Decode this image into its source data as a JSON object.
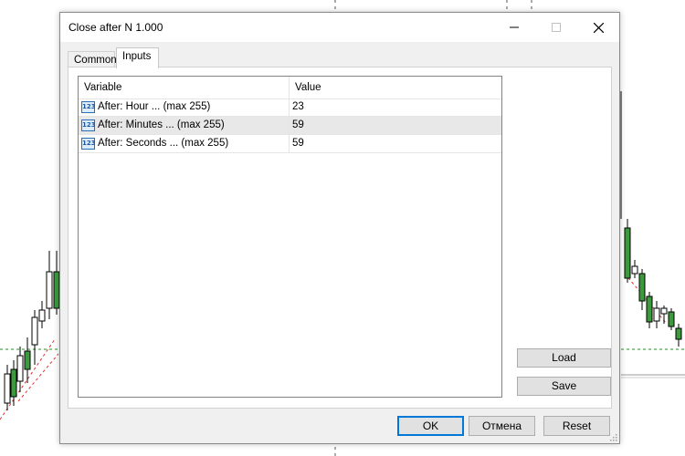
{
  "window": {
    "title": "Close after N 1.000",
    "minimize_icon": "minimize-icon",
    "maximize_icon": "maximize-icon",
    "close_icon": "close-icon"
  },
  "tabs": [
    {
      "label": "Common",
      "active": false
    },
    {
      "label": "Inputs",
      "active": true
    }
  ],
  "table": {
    "columns": {
      "variable": "Variable",
      "value": "Value"
    },
    "rows": [
      {
        "icon": "integer-type-icon",
        "variable": "After: Hour ... (max 255)",
        "value": "23",
        "selected": false
      },
      {
        "icon": "integer-type-icon",
        "variable": "After: Minutes ... (max 255)",
        "value": "59",
        "selected": true
      },
      {
        "icon": "integer-type-icon",
        "variable": "After: Seconds ... (max 255)",
        "value": "59",
        "selected": false
      }
    ]
  },
  "buttons": {
    "load": "Load",
    "save": "Save",
    "ok": "OK",
    "cancel": "Отмена",
    "reset": "Reset"
  },
  "colors": {
    "accent": "#0078d7",
    "bull_candle": "#3c9a3c",
    "bear_candle": "#e03030",
    "row_selected": "#e8e8e8"
  }
}
